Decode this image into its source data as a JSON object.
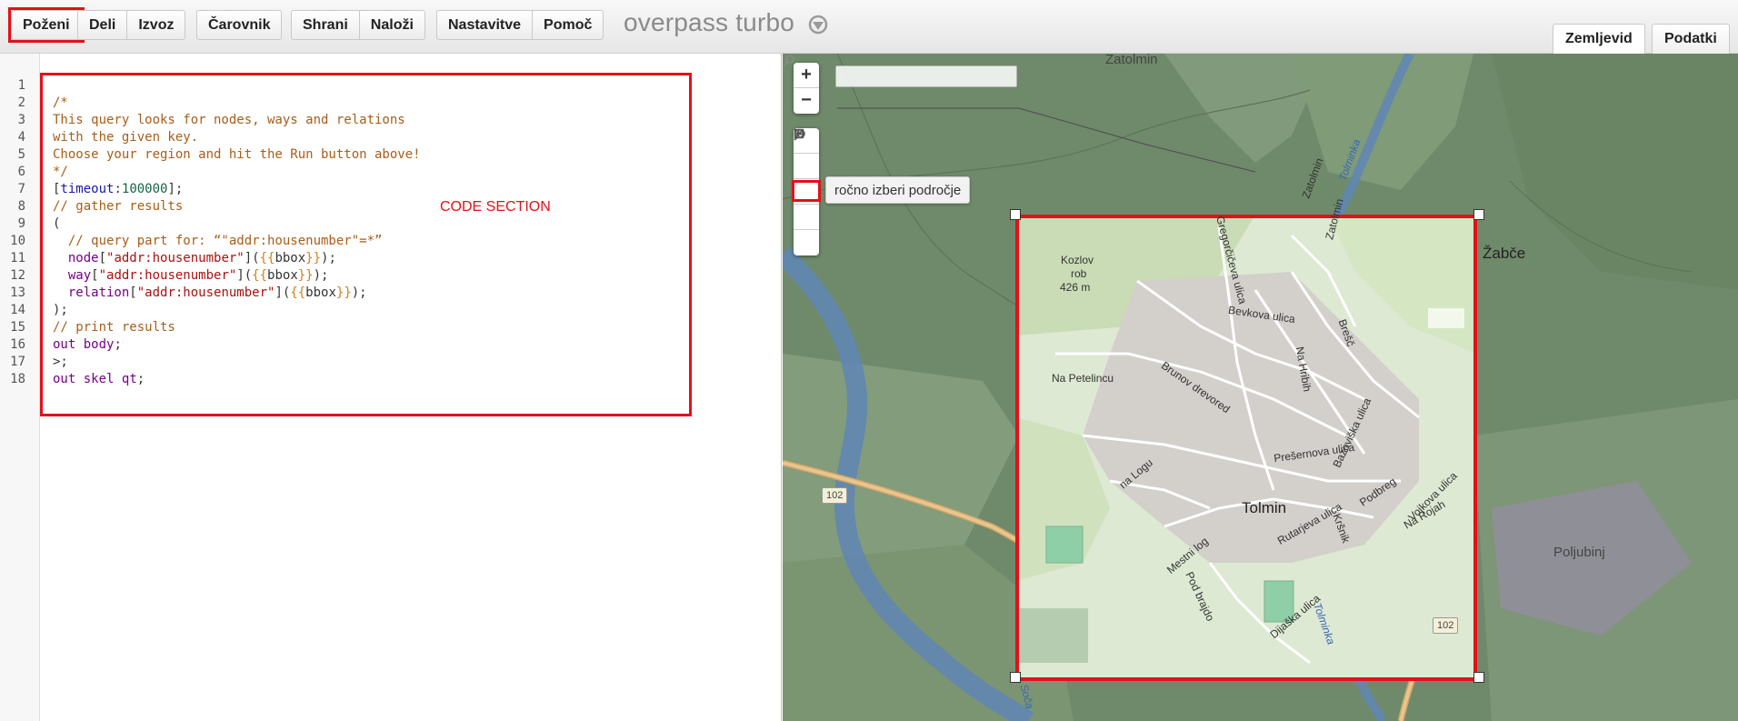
{
  "toolbar": {
    "run": "Poženi",
    "share": "Deli",
    "export": "Izvoz",
    "wizard": "Čarovnik",
    "save": "Shrani",
    "load": "Naloži",
    "settings": "Nastavitve",
    "help": "Pomoč",
    "app_title": "overpass turbo"
  },
  "view_tabs": {
    "map": "Zemljevid",
    "data": "Podatki"
  },
  "editor": {
    "line_numbers": [
      "1",
      "2",
      "3",
      "4",
      "5",
      "6",
      "7",
      "8",
      "9",
      "10",
      "11",
      "12",
      "13",
      "14",
      "15",
      "16",
      "17",
      "18"
    ],
    "annotation": "CODE SECTION",
    "lines": [
      [],
      [
        {
          "t": "/*",
          "c": "comment"
        }
      ],
      [
        {
          "t": "This query looks for nodes, ways and relations",
          "c": "comment"
        }
      ],
      [
        {
          "t": "with the given key.",
          "c": "comment"
        }
      ],
      [
        {
          "t": "Choose your region and hit the Run button above!",
          "c": "comment"
        }
      ],
      [
        {
          "t": "*/",
          "c": "comment"
        }
      ],
      [
        {
          "t": "[",
          "c": "punct"
        },
        {
          "t": "timeout",
          "c": "key"
        },
        {
          "t": ":",
          "c": "punct"
        },
        {
          "t": "100000",
          "c": "num"
        },
        {
          "t": "];",
          "c": "punct"
        }
      ],
      [
        {
          "t": "// gather results",
          "c": "comment"
        }
      ],
      [
        {
          "t": "(",
          "c": "punct"
        }
      ],
      [
        {
          "t": "  // query part for: “\"addr:housenumber\"=*”",
          "c": "comment"
        }
      ],
      [
        {
          "t": "  ",
          "c": "punct"
        },
        {
          "t": "node",
          "c": "kw"
        },
        {
          "t": "[",
          "c": "punct"
        },
        {
          "t": "\"addr:housenumber\"",
          "c": "str"
        },
        {
          "t": "](",
          "c": "punct"
        },
        {
          "t": "{{",
          "c": "tpl"
        },
        {
          "t": "bbox",
          "c": "punct"
        },
        {
          "t": "}}",
          "c": "tpl"
        },
        {
          "t": ");",
          "c": "punct"
        }
      ],
      [
        {
          "t": "  ",
          "c": "punct"
        },
        {
          "t": "way",
          "c": "kw"
        },
        {
          "t": "[",
          "c": "punct"
        },
        {
          "t": "\"addr:housenumber\"",
          "c": "str"
        },
        {
          "t": "](",
          "c": "punct"
        },
        {
          "t": "{{",
          "c": "tpl"
        },
        {
          "t": "bbox",
          "c": "punct"
        },
        {
          "t": "}}",
          "c": "tpl"
        },
        {
          "t": ");",
          "c": "punct"
        }
      ],
      [
        {
          "t": "  ",
          "c": "punct"
        },
        {
          "t": "relation",
          "c": "kw"
        },
        {
          "t": "[",
          "c": "punct"
        },
        {
          "t": "\"addr:housenumber\"",
          "c": "str"
        },
        {
          "t": "](",
          "c": "punct"
        },
        {
          "t": "{{",
          "c": "tpl"
        },
        {
          "t": "bbox",
          "c": "punct"
        },
        {
          "t": "}}",
          "c": "tpl"
        },
        {
          "t": ");",
          "c": "punct"
        }
      ],
      [
        {
          "t": ");",
          "c": "punct"
        }
      ],
      [
        {
          "t": "// print results",
          "c": "comment"
        }
      ],
      [
        {
          "t": "out",
          "c": "kw"
        },
        {
          "t": " ",
          "c": "punct"
        },
        {
          "t": "body",
          "c": "kw"
        },
        {
          "t": ";",
          "c": "punct"
        }
      ],
      [
        {
          "t": ">;",
          "c": "punct"
        }
      ],
      [
        {
          "t": "out",
          "c": "kw"
        },
        {
          "t": " ",
          "c": "punct"
        },
        {
          "t": "skel",
          "c": "kw"
        },
        {
          "t": " ",
          "c": "punct"
        },
        {
          "t": "qt",
          "c": "kw"
        },
        {
          "t": ";",
          "c": "punct"
        }
      ]
    ]
  },
  "map": {
    "zoom_in": "+",
    "zoom_out": "−",
    "search_placeholder": "",
    "tools": [
      "magnifier-icon",
      "circle-icon",
      "bbox-select-icon",
      "skip-back-icon",
      "no-entry-icon"
    ],
    "tooltip": "ročno izberi področje",
    "labels": {
      "town": "Tolmin",
      "zatolmin": "Zatolmin",
      "zabce": "Žabče",
      "poljubinj": "Poljubinj",
      "kozlov": "Kozlov",
      "rob": "rob",
      "elevation": "426 m",
      "gregorciceva": "Gregorčičeva ulica",
      "bevkova": "Bevkova ulica",
      "na_petelincu": "Na Petelincu",
      "brunov": "Brunov drevored",
      "na_hribih": "Na Hribih",
      "brescu": "Brešč",
      "preseren": "Prešernova ulica",
      "bazoviska": "Bazoviška ulica",
      "na_logu": "na Logu",
      "mestni_log": "Mestni log",
      "rutarjeva": "Rutarjeva ulica",
      "podbreg": "Podbreg",
      "krisnik": "Kršnik",
      "vojkova": "Vojkova ulica",
      "na_rojah": "Na Rojah",
      "pod_brajdo": "Pod brajdo",
      "dijaska": "Dijaška ulica",
      "tolminka": "Tolminka",
      "tolminka2": "Tolminka",
      "zatolmin_road": "Zatolmin",
      "zatolmin_road2": "Zatolmin",
      "soca": "Soča",
      "road_102a": "102",
      "road_102b": "102"
    }
  }
}
